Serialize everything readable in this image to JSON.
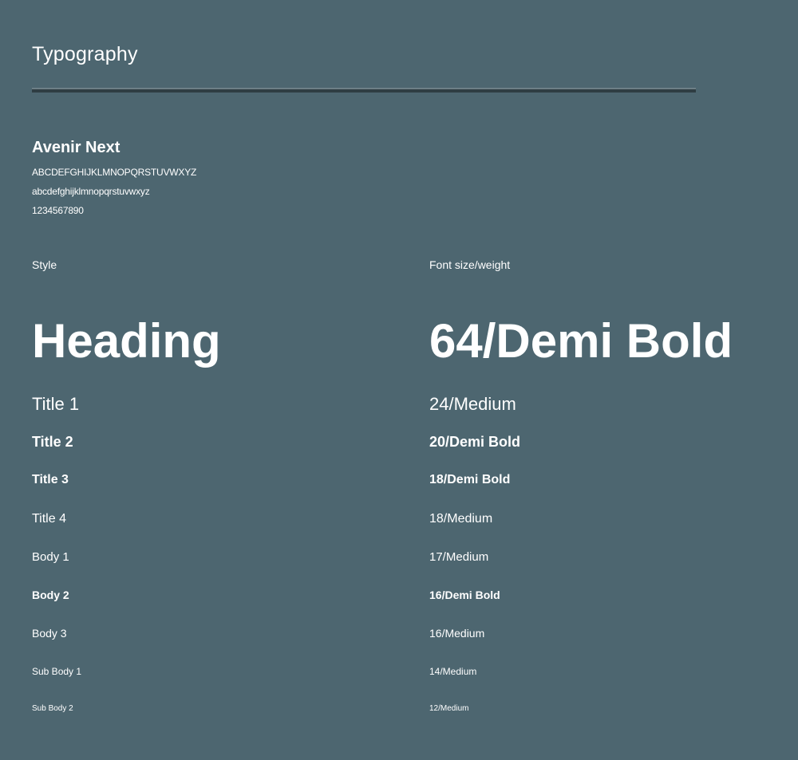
{
  "page_title": "Typography",
  "font": {
    "name": "Avenir Next",
    "uppercase": "ABCDEFGHIJKLMNOPQRSTUVWXYZ",
    "lowercase": "abcdefghijklmnopqrstuvwxyz",
    "digits": "1234567890"
  },
  "columns": {
    "style": "Style",
    "size_weight": "Font size/weight"
  },
  "styles": [
    {
      "name": "Heading",
      "spec": "64/Demi Bold"
    },
    {
      "name": "Title 1",
      "spec": "24/Medium"
    },
    {
      "name": "Title 2",
      "spec": "20/Demi Bold"
    },
    {
      "name": "Title 3",
      "spec": "18/Demi Bold"
    },
    {
      "name": "Title 4",
      "spec": "18/Medium"
    },
    {
      "name": "Body 1",
      "spec": "17/Medium"
    },
    {
      "name": "Body 2",
      "spec": "16/Demi Bold"
    },
    {
      "name": "Body 3",
      "spec": "16/Medium"
    },
    {
      "name": "Sub Body 1",
      "spec": "14/Medium"
    },
    {
      "name": "Sub Body 2",
      "spec": "12/Medium"
    }
  ]
}
